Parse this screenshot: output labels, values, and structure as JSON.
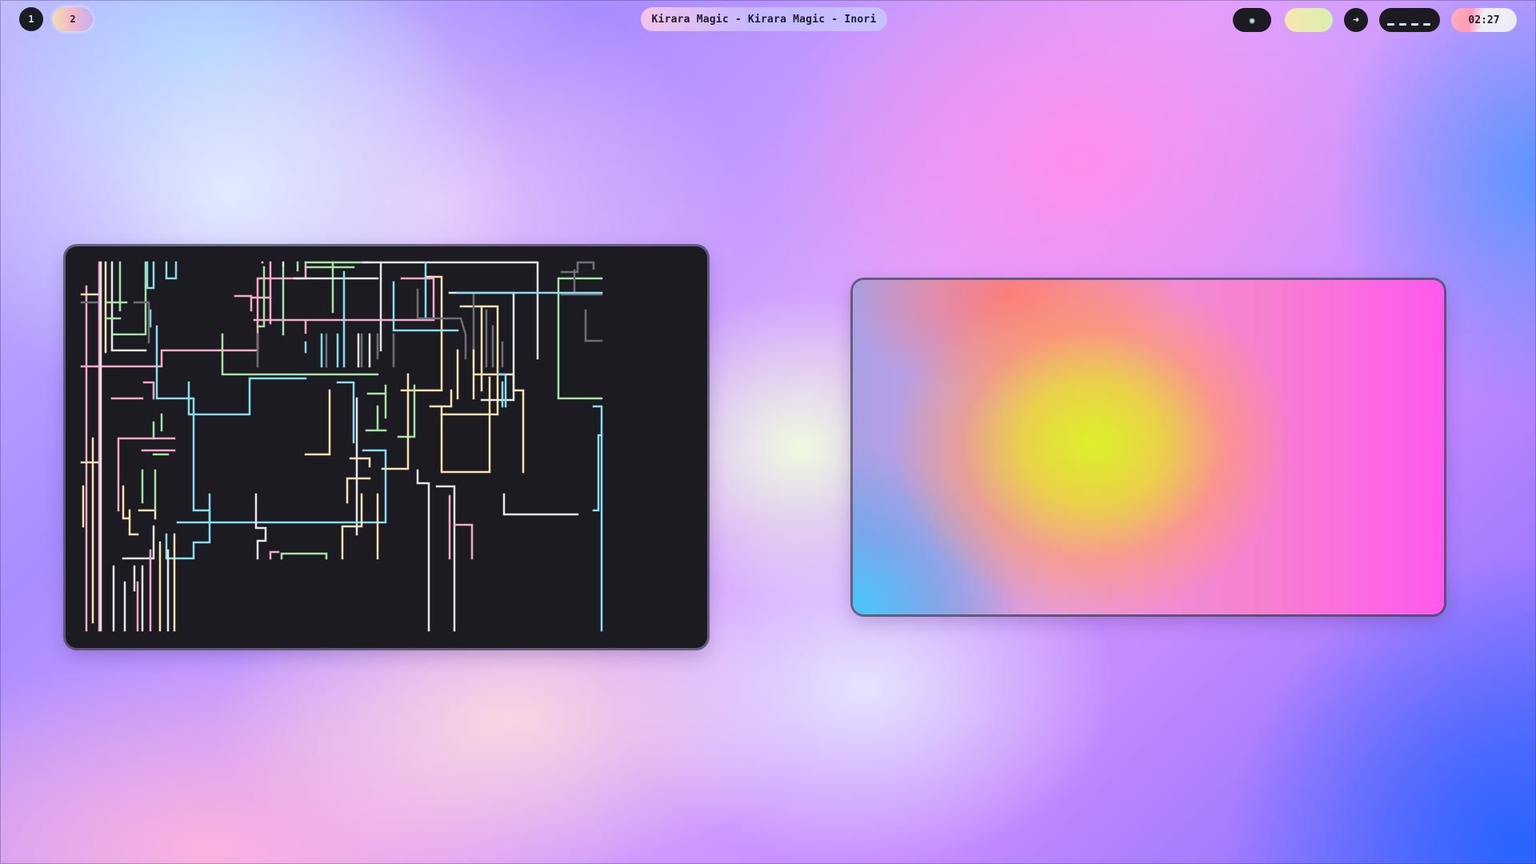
{
  "topbar": {
    "workspaces": [
      {
        "label": "1",
        "active": false
      },
      {
        "label": "2",
        "active": true
      }
    ],
    "window_title": "Kirara Magic - Kirara Magic - Inori",
    "camera_icon": "camera-icon",
    "forward_icon": "arrow-right-icon",
    "clock": "02:27"
  },
  "windows": [
    {
      "name": "terminal-pipes",
      "background": "#1c1b22"
    },
    {
      "name": "gradient-preview"
    }
  ],
  "colors": {
    "pink": "#f4a9c8",
    "green": "#a6e3a1",
    "yellow": "#f9e2af",
    "blue": "#89dceb",
    "white": "#e6e6ee",
    "gray": "#6e6e7a"
  }
}
